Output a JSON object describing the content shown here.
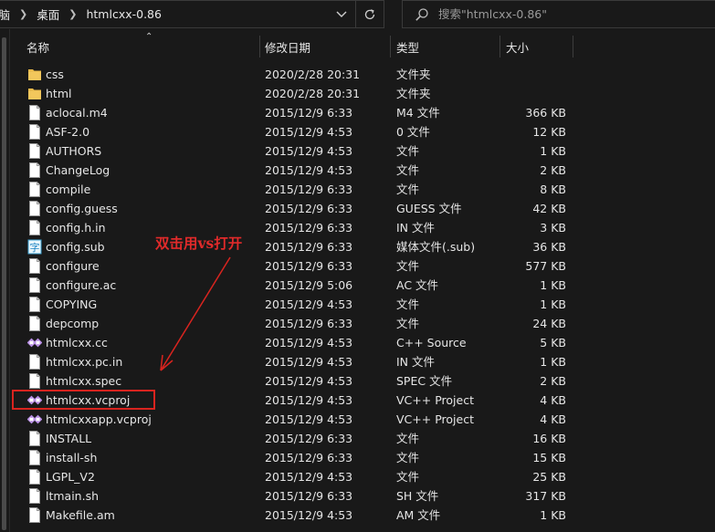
{
  "breadcrumb": {
    "items": [
      "电脑",
      "桌面",
      "htmlcxx-0.86"
    ]
  },
  "search": {
    "placeholder": "搜索\"htmlcxx-0.86\""
  },
  "columns": {
    "name": "名称",
    "date": "修改日期",
    "type": "类型",
    "size": "大小"
  },
  "files": [
    {
      "icon": "folder-icon",
      "name": "css",
      "date": "2020/2/28 20:31",
      "type": "文件夹",
      "size": ""
    },
    {
      "icon": "folder-icon",
      "name": "html",
      "date": "2020/2/28 20:31",
      "type": "文件夹",
      "size": ""
    },
    {
      "icon": "file-icon",
      "name": "aclocal.m4",
      "date": "2015/12/9 6:33",
      "type": "M4 文件",
      "size": "366 KB"
    },
    {
      "icon": "file-icon",
      "name": "ASF-2.0",
      "date": "2015/12/9 4:53",
      "type": "0 文件",
      "size": "12 KB"
    },
    {
      "icon": "file-icon",
      "name": "AUTHORS",
      "date": "2015/12/9 4:53",
      "type": "文件",
      "size": "1 KB"
    },
    {
      "icon": "file-icon",
      "name": "ChangeLog",
      "date": "2015/12/9 4:53",
      "type": "文件",
      "size": "2 KB"
    },
    {
      "icon": "file-icon",
      "name": "compile",
      "date": "2015/12/9 6:33",
      "type": "文件",
      "size": "8 KB"
    },
    {
      "icon": "file-icon",
      "name": "config.guess",
      "date": "2015/12/9 6:33",
      "type": "GUESS 文件",
      "size": "42 KB"
    },
    {
      "icon": "file-icon",
      "name": "config.h.in",
      "date": "2015/12/9 6:33",
      "type": "IN 文件",
      "size": "3 KB"
    },
    {
      "icon": "subtitle-file-icon",
      "name": "config.sub",
      "date": "2015/12/9 6:33",
      "type": "媒体文件(.sub)",
      "size": "36 KB"
    },
    {
      "icon": "file-icon",
      "name": "configure",
      "date": "2015/12/9 6:33",
      "type": "文件",
      "size": "577 KB"
    },
    {
      "icon": "file-icon",
      "name": "configure.ac",
      "date": "2015/12/9 5:06",
      "type": "AC 文件",
      "size": "1 KB"
    },
    {
      "icon": "file-icon",
      "name": "COPYING",
      "date": "2015/12/9 4:53",
      "type": "文件",
      "size": "1 KB"
    },
    {
      "icon": "file-icon",
      "name": "depcomp",
      "date": "2015/12/9 6:33",
      "type": "文件",
      "size": "24 KB"
    },
    {
      "icon": "vs-project-icon",
      "name": "htmlcxx.cc",
      "date": "2015/12/9 4:53",
      "type": "C++ Source",
      "size": "5 KB"
    },
    {
      "icon": "file-icon",
      "name": "htmlcxx.pc.in",
      "date": "2015/12/9 4:53",
      "type": "IN 文件",
      "size": "1 KB"
    },
    {
      "icon": "file-icon",
      "name": "htmlcxx.spec",
      "date": "2015/12/9 4:53",
      "type": "SPEC 文件",
      "size": "2 KB"
    },
    {
      "icon": "vs-project-icon",
      "name": "htmlcxx.vcproj",
      "date": "2015/12/9 4:53",
      "type": "VC++ Project",
      "size": "4 KB"
    },
    {
      "icon": "vs-project-icon",
      "name": "htmlcxxapp.vcproj",
      "date": "2015/12/9 4:53",
      "type": "VC++ Project",
      "size": "4 KB"
    },
    {
      "icon": "file-icon",
      "name": "INSTALL",
      "date": "2015/12/9 6:33",
      "type": "文件",
      "size": "16 KB"
    },
    {
      "icon": "file-icon",
      "name": "install-sh",
      "date": "2015/12/9 6:33",
      "type": "文件",
      "size": "15 KB"
    },
    {
      "icon": "file-icon",
      "name": "LGPL_V2",
      "date": "2015/12/9 4:53",
      "type": "文件",
      "size": "25 KB"
    },
    {
      "icon": "file-icon",
      "name": "ltmain.sh",
      "date": "2015/12/9 6:33",
      "type": "SH 文件",
      "size": "317 KB"
    },
    {
      "icon": "file-icon",
      "name": "Makefile.am",
      "date": "2015/12/9 4:53",
      "type": "AM 文件",
      "size": "1 KB"
    }
  ],
  "annotation": {
    "text": "双击用vs打开",
    "color": "#d9241f"
  },
  "colors": {
    "background": "#191919",
    "text": "#e6e6e6",
    "folder": "#e8b94a",
    "accent_red": "#d9241f"
  }
}
